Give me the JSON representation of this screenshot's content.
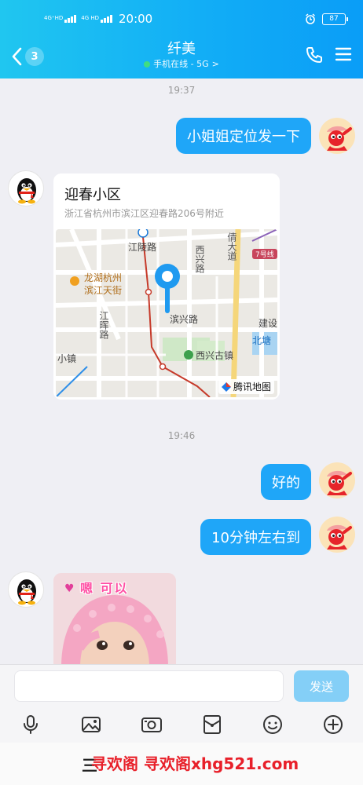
{
  "status_bar": {
    "network_1": "4G⁺HD",
    "network_2": "4G HD",
    "time": "20:00",
    "alarm_icon": "alarm-clock-icon",
    "battery": "87"
  },
  "header": {
    "back_icon": "chevron-left-icon",
    "unread_count": "3",
    "title": "纤美",
    "subtitle": "手机在线 - 5G",
    "subtitle_arrow": ">",
    "call_icon": "phone-icon",
    "menu_icon": "menu-icon"
  },
  "messages": {
    "ts1": "19:37",
    "msg1": "小姐姐定位发一下",
    "location": {
      "name": "迎春小区",
      "address": "浙江省杭州市滨江区迎春路206号附近",
      "map_labels": {
        "jiangling": "江陵路",
        "xixing": "西兴路",
        "qingdadao": "倩大道",
        "line7": "7号线",
        "longhu1": "龙湖杭州",
        "longhu2": "滨江天街",
        "jianghui": "江晖路",
        "binxing": "滨兴路",
        "jianshe": "建设",
        "beitang": "北塘",
        "xiaozhen": "小镇",
        "xixingguzhen": "西兴古镇"
      },
      "map_provider": "腾讯地图"
    },
    "ts2": "19:46",
    "msg2": "好的",
    "msg3": "10分钟左右到",
    "sticker_text": "嗯 可以"
  },
  "input": {
    "placeholder": "",
    "send_label": "发送"
  },
  "toolbar": {
    "items": [
      "microphone-icon",
      "image-icon",
      "camera-icon",
      "red-packet-icon",
      "emoji-icon",
      "plus-icon"
    ]
  },
  "navbar": {
    "prefix": "三",
    "watermark": "寻欢阁 寻欢阁xhg521.com"
  },
  "colors": {
    "header_gradient_start": "#20c6f0",
    "header_gradient_end": "#0a9df7",
    "my_bubble": "#1fa6f8",
    "send_button": "#84cff7",
    "background": "#efeff4",
    "watermark": "#e8202a"
  }
}
